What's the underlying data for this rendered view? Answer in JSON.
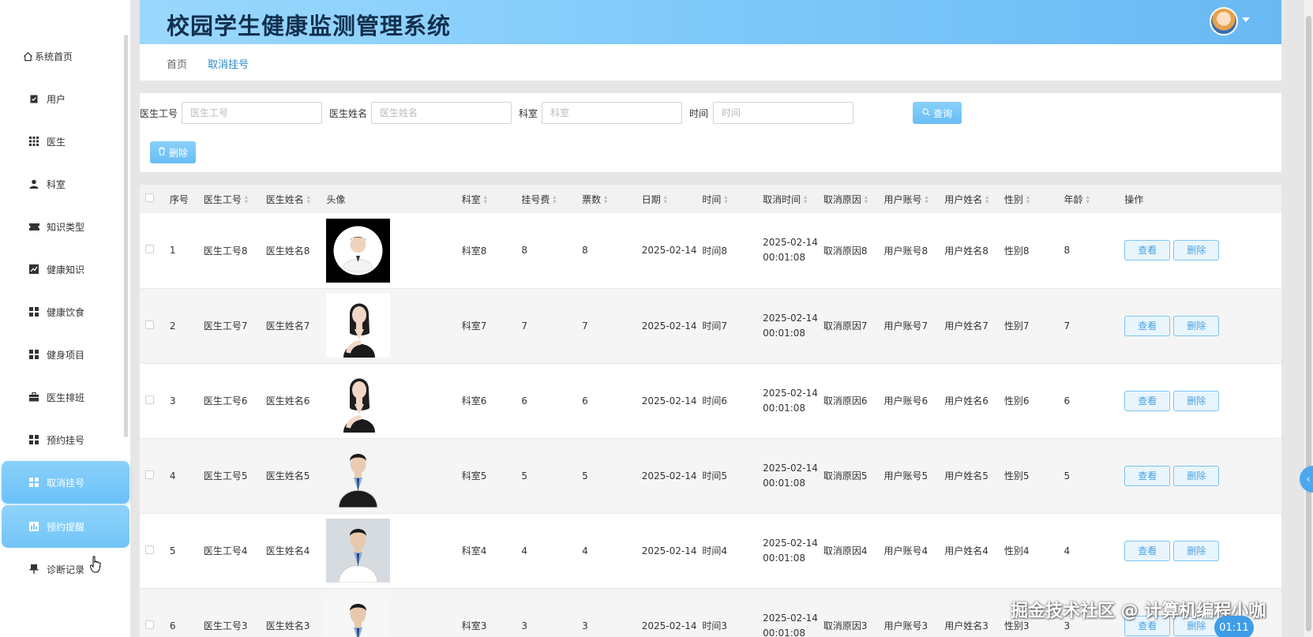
{
  "app": {
    "title": "校园学生健康监测管理系统"
  },
  "sidebar": {
    "items": [
      {
        "label": "系统首页",
        "icon": "home-icon"
      },
      {
        "label": "用户",
        "icon": "clipboard-icon"
      },
      {
        "label": "医生",
        "icon": "grid-icon"
      },
      {
        "label": "科室",
        "icon": "person-icon"
      },
      {
        "label": "知识类型",
        "icon": "ticket-icon"
      },
      {
        "label": "健康知识",
        "icon": "chart-icon"
      },
      {
        "label": "健康饮食",
        "icon": "apps-icon"
      },
      {
        "label": "健身项目",
        "icon": "apps-icon"
      },
      {
        "label": "医生排班",
        "icon": "briefcase-icon"
      },
      {
        "label": "预约挂号",
        "icon": "apps-icon"
      },
      {
        "label": "取消挂号",
        "icon": "apps-icon"
      },
      {
        "label": "预约提醒",
        "icon": "bar-chart-icon"
      },
      {
        "label": "诊断记录",
        "icon": "pushpin-icon"
      }
    ]
  },
  "breadcrumb": {
    "home": "首页",
    "current": "取消挂号"
  },
  "search": {
    "doctor_id_label": "医生工号",
    "doctor_id_placeholder": "医生工号",
    "doctor_name_label": "医生姓名",
    "doctor_name_placeholder": "医生姓名",
    "dept_label": "科室",
    "dept_placeholder": "科室",
    "time_label": "时间",
    "time_placeholder": "时间",
    "query_label": "查询",
    "delete_label": "删除"
  },
  "table": {
    "headers": [
      "序号",
      "医生工号",
      "医生姓名",
      "头像",
      "科室",
      "挂号费",
      "票数",
      "日期",
      "时间",
      "取消时间",
      "取消原因",
      "用户账号",
      "用户姓名",
      "性别",
      "年龄",
      "操作"
    ],
    "view_label": "查看",
    "delete_label": "删除",
    "rows": [
      {
        "no": "1",
        "doc_id": "医生工号8",
        "doc_name": "医生姓名8",
        "dept": "科室8",
        "fee": "8",
        "tickets": "8",
        "date": "2025-02-14",
        "time": "时间8",
        "cancel_date": "2025-02-14",
        "cancel_clock": "00:01:08",
        "reason": "取消原因8",
        "account": "用户账号8",
        "user_name": "用户姓名8",
        "gender": "性别8",
        "age": "8"
      },
      {
        "no": "2",
        "doc_id": "医生工号7",
        "doc_name": "医生姓名7",
        "dept": "科室7",
        "fee": "7",
        "tickets": "7",
        "date": "2025-02-14",
        "time": "时间7",
        "cancel_date": "2025-02-14",
        "cancel_clock": "00:01:08",
        "reason": "取消原因7",
        "account": "用户账号7",
        "user_name": "用户姓名7",
        "gender": "性别7",
        "age": "7"
      },
      {
        "no": "3",
        "doc_id": "医生工号6",
        "doc_name": "医生姓名6",
        "dept": "科室6",
        "fee": "6",
        "tickets": "6",
        "date": "2025-02-14",
        "time": "时间6",
        "cancel_date": "2025-02-14",
        "cancel_clock": "00:01:08",
        "reason": "取消原因6",
        "account": "用户账号6",
        "user_name": "用户姓名6",
        "gender": "性别6",
        "age": "6"
      },
      {
        "no": "4",
        "doc_id": "医生工号5",
        "doc_name": "医生姓名5",
        "dept": "科室5",
        "fee": "5",
        "tickets": "5",
        "date": "2025-02-14",
        "time": "时间5",
        "cancel_date": "2025-02-14",
        "cancel_clock": "00:01:08",
        "reason": "取消原因5",
        "account": "用户账号5",
        "user_name": "用户姓名5",
        "gender": "性别5",
        "age": "5"
      },
      {
        "no": "5",
        "doc_id": "医生工号4",
        "doc_name": "医生姓名4",
        "dept": "科室4",
        "fee": "4",
        "tickets": "4",
        "date": "2025-02-14",
        "time": "时间4",
        "cancel_date": "2025-02-14",
        "cancel_clock": "00:01:08",
        "reason": "取消原因4",
        "account": "用户账号4",
        "user_name": "用户姓名4",
        "gender": "性别4",
        "age": "4"
      },
      {
        "no": "6",
        "doc_id": "医生工号3",
        "doc_name": "医生姓名3",
        "dept": "科室3",
        "fee": "3",
        "tickets": "3",
        "date": "2025-02-14",
        "time": "时间3",
        "cancel_date": "2025-02-14",
        "cancel_clock": "00:01:08",
        "reason": "取消原因3",
        "account": "用户账号3",
        "user_name": "用户姓名3",
        "gender": "性别3",
        "age": "3"
      }
    ]
  },
  "watermark": "掘金技术社区 @ 计算机编程小咖",
  "timer": "01:11"
}
